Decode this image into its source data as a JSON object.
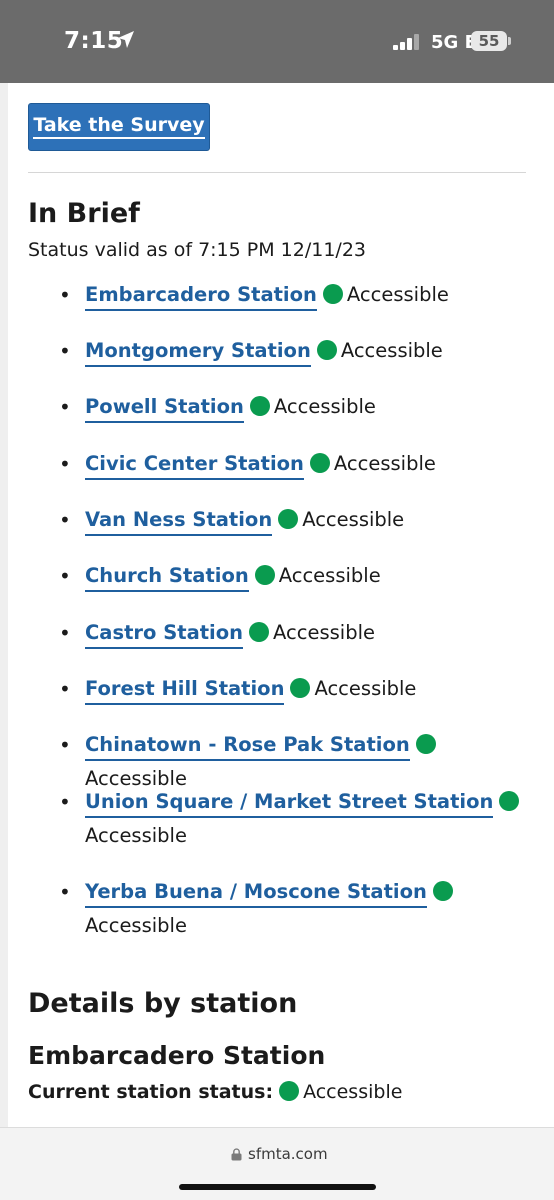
{
  "status_bar": {
    "time": "7:15",
    "network": "5G E",
    "battery": "55"
  },
  "survey_button": {
    "label": "Take the Survey"
  },
  "in_brief": {
    "title": "In Brief",
    "status_valid": "Status valid as of 7:15 PM 12/11/23"
  },
  "status_color": "#0a9b4f",
  "link_color": "#1f5f9e",
  "stations": [
    {
      "name": "Embarcadero Station",
      "status": "Accessible"
    },
    {
      "name": "Montgomery Station",
      "status": "Accessible"
    },
    {
      "name": "Powell Station",
      "status": "Accessible"
    },
    {
      "name": "Civic Center Station",
      "status": "Accessible"
    },
    {
      "name": "Van Ness Station",
      "status": "Accessible"
    },
    {
      "name": "Church Station",
      "status": "Accessible"
    },
    {
      "name": "Castro Station",
      "status": "Accessible"
    },
    {
      "name": "Forest Hill Station",
      "status": "Accessible"
    },
    {
      "name": "Chinatown - Rose Pak Station",
      "status": "Accessible"
    },
    {
      "name": "Union Square / Market Street Station",
      "status": "Accessible"
    },
    {
      "name": "Yerba Buena / Moscone Station",
      "status": "Accessible"
    }
  ],
  "details": {
    "title": "Details by station",
    "station_name": "Embarcadero Station",
    "current_status_label": "Current station status:",
    "current_status_value": "Accessible"
  },
  "browser": {
    "url": "sfmta.com"
  }
}
